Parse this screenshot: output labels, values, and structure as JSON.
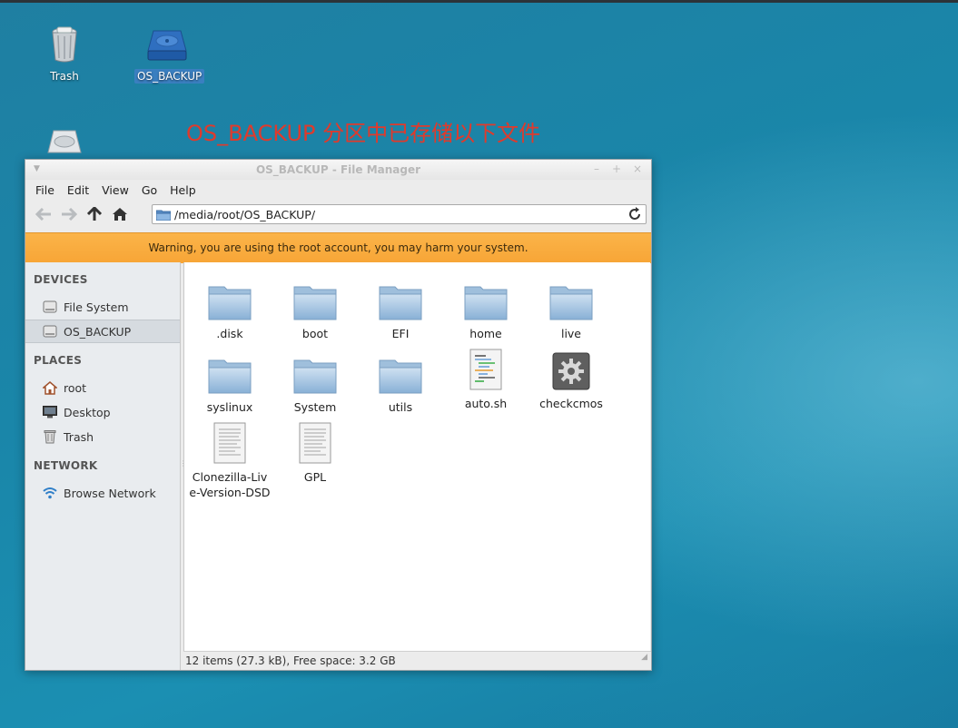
{
  "desktop": {
    "icons": [
      {
        "label": "Trash"
      },
      {
        "label": "OS_BACKUP"
      },
      {
        "label": ""
      }
    ],
    "headline": "OS_BACKUP 分区中已存储以下文件"
  },
  "window": {
    "title": "OS_BACKUP - File Manager",
    "controls": {
      "minimize": "–",
      "maximize": "+",
      "close": "×"
    },
    "menu": [
      "File",
      "Edit",
      "View",
      "Go",
      "Help"
    ],
    "path": "/media/root/OS_BACKUP/",
    "warning": "Warning, you are using the root account, you may harm your system.",
    "sidebar": {
      "devices_header": "DEVICES",
      "devices": [
        {
          "label": "File System",
          "icon": "drive-icon"
        },
        {
          "label": "OS_BACKUP",
          "icon": "drive-icon",
          "active": true
        }
      ],
      "places_header": "PLACES",
      "places": [
        {
          "label": "root",
          "icon": "home-icon"
        },
        {
          "label": "Desktop",
          "icon": "desktop-icon"
        },
        {
          "label": "Trash",
          "icon": "trash-icon"
        }
      ],
      "network_header": "NETWORK",
      "network": [
        {
          "label": "Browse Network",
          "icon": "wifi-icon"
        }
      ]
    },
    "files": [
      {
        "name": ".disk",
        "type": "folder"
      },
      {
        "name": "boot",
        "type": "folder"
      },
      {
        "name": "EFI",
        "type": "folder"
      },
      {
        "name": "home",
        "type": "folder"
      },
      {
        "name": "live",
        "type": "folder"
      },
      {
        "name": "syslinux",
        "type": "folder"
      },
      {
        "name": "System",
        "type": "folder"
      },
      {
        "name": "utils",
        "type": "folder"
      },
      {
        "name": "auto.sh",
        "type": "script"
      },
      {
        "name": "checkcmos",
        "type": "executable"
      },
      {
        "name": "Clonezilla-Live-Version-DSD",
        "type": "text"
      },
      {
        "name": "GPL",
        "type": "text"
      }
    ],
    "status": "12 items (27.3 kB), Free space: 3.2 GB"
  }
}
